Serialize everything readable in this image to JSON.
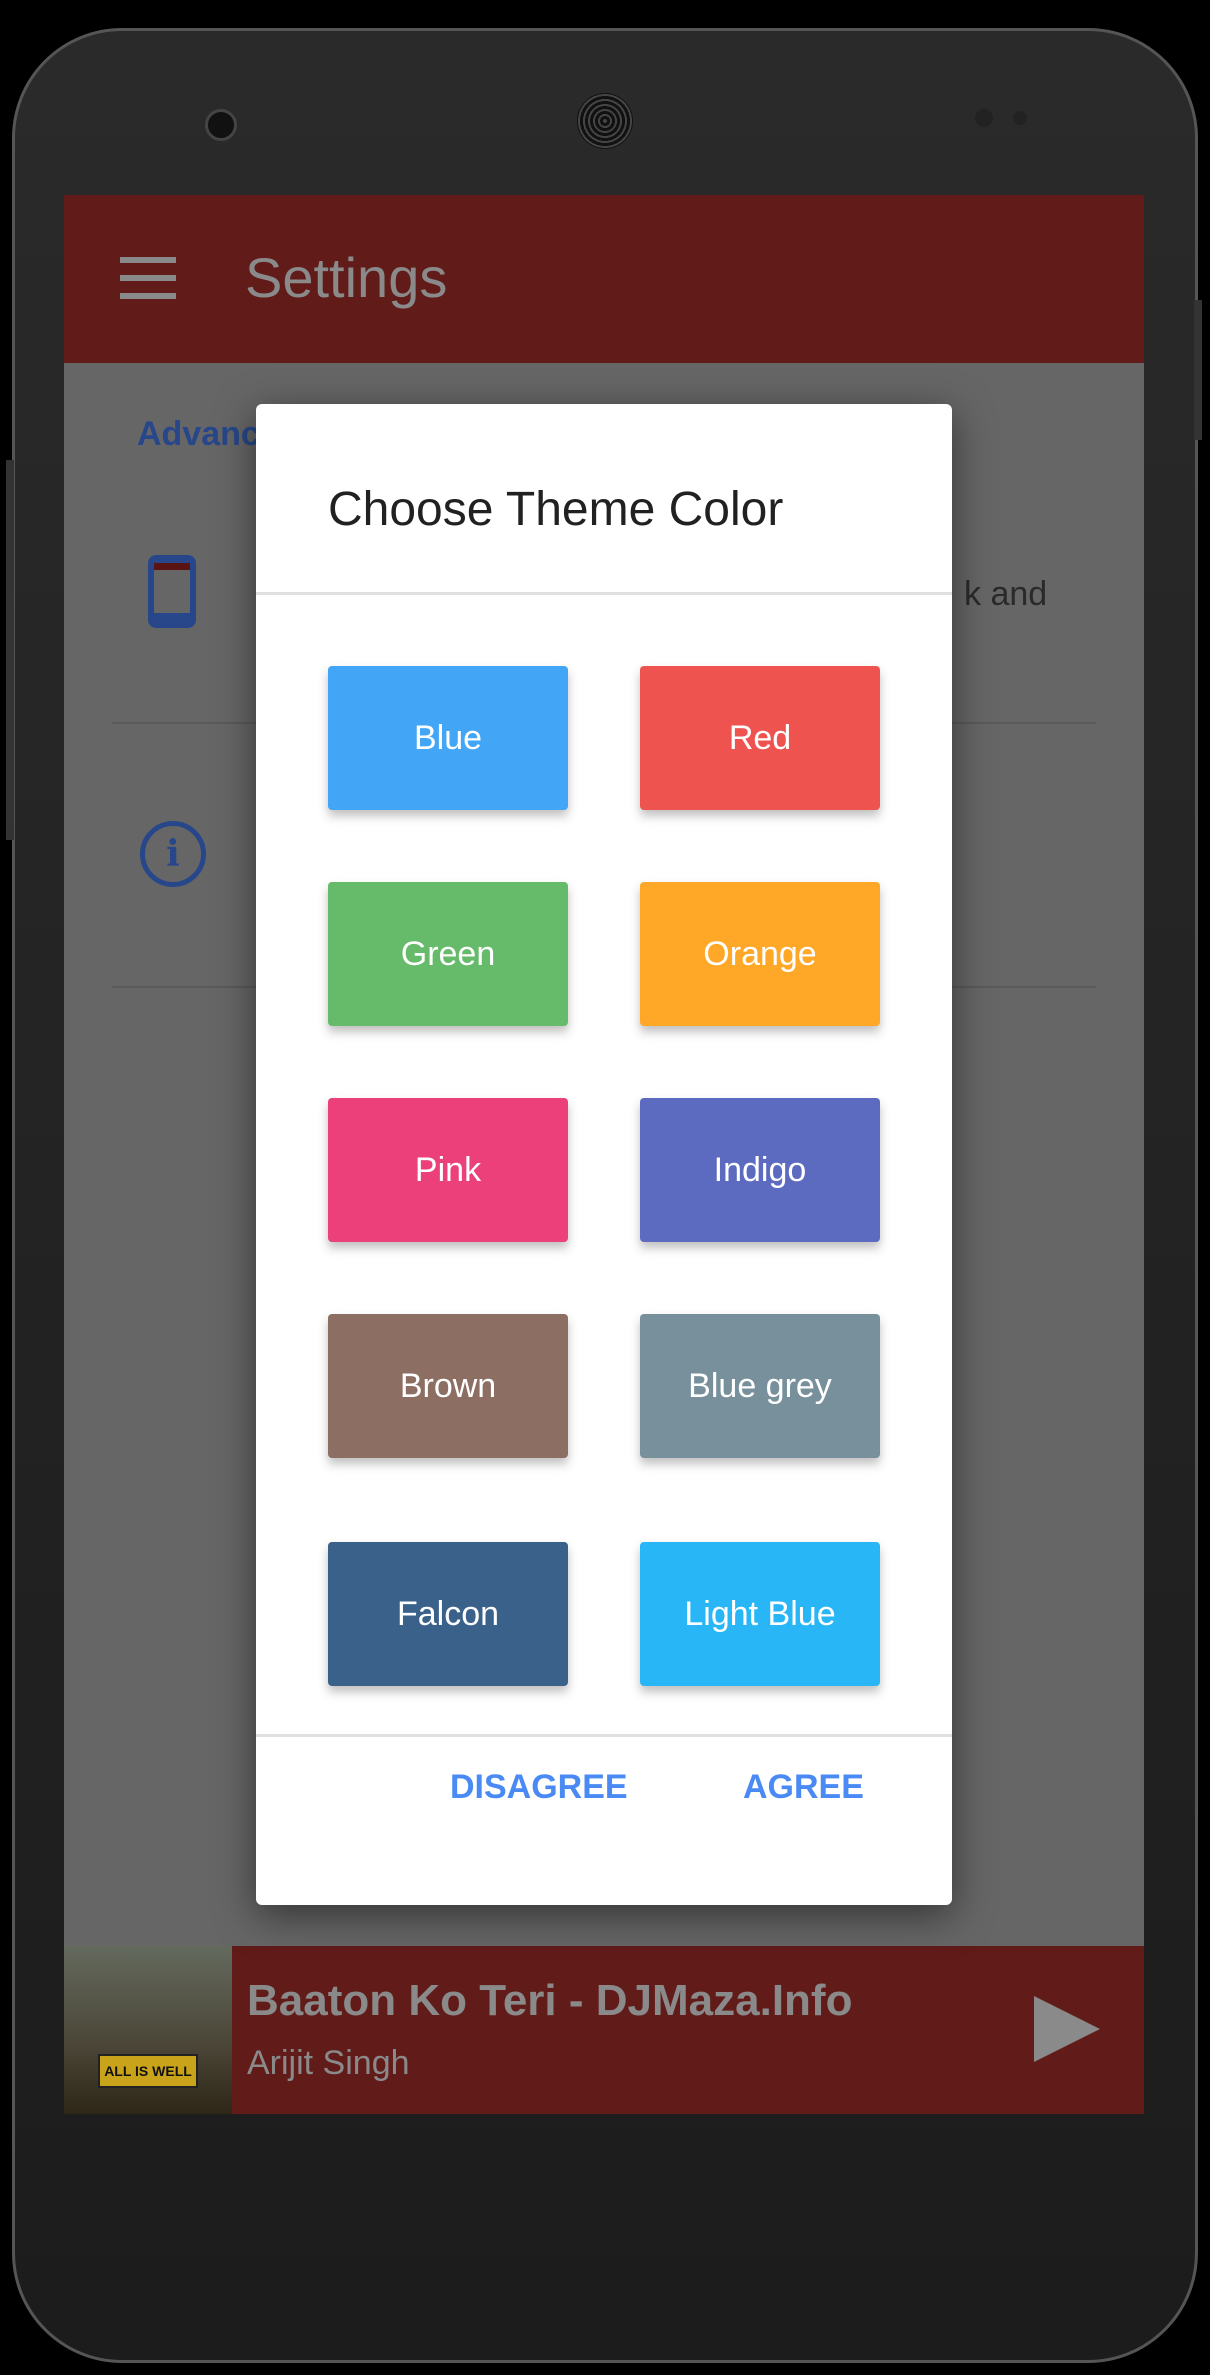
{
  "toolbar": {
    "title": "Settings",
    "color": "#F44336"
  },
  "settings": {
    "section_label": "Advanc",
    "visible_fragment": "k and"
  },
  "dialog": {
    "title": "Choose Theme Color",
    "colors": [
      {
        "label": "Blue",
        "color": "#42A5F5"
      },
      {
        "label": "Red",
        "color": "#EF5350"
      },
      {
        "label": "Green",
        "color": "#66BB6A"
      },
      {
        "label": "Orange",
        "color": "#FFA726"
      },
      {
        "label": "Pink",
        "color": "#EC407A"
      },
      {
        "label": "Indigo",
        "color": "#5C6BC0"
      },
      {
        "label": "Brown",
        "color": "#8D6E63"
      },
      {
        "label": "Blue grey",
        "color": "#78909C"
      },
      {
        "label": "Falcon",
        "color": "#3A6189"
      },
      {
        "label": "Light Blue",
        "color": "#29B6F6"
      }
    ],
    "disagree": "DISAGREE",
    "agree": "AGREE"
  },
  "player": {
    "song": "Baaton Ko Teri - DJMaza.Info",
    "artist": "Arijit Singh",
    "art_text": "ALL IS WELL"
  }
}
